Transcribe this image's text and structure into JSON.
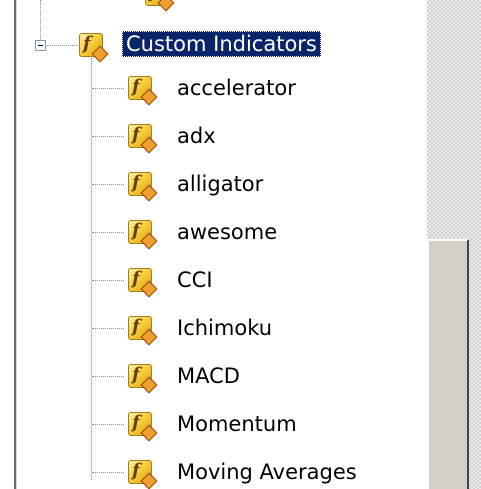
{
  "tree": {
    "parent": {
      "label": "Custom Indicators",
      "icon": "function-icon",
      "expanded": true
    },
    "items": [
      {
        "label": "accelerator",
        "icon": "function-icon"
      },
      {
        "label": "adx",
        "icon": "function-icon"
      },
      {
        "label": "alligator",
        "icon": "function-icon"
      },
      {
        "label": "awesome",
        "icon": "function-icon"
      },
      {
        "label": "CCI",
        "icon": "function-icon"
      },
      {
        "label": "Ichimoku",
        "icon": "function-icon"
      },
      {
        "label": "MACD",
        "icon": "function-icon"
      },
      {
        "label": "Momentum",
        "icon": "function-icon"
      },
      {
        "label": "Moving Averages",
        "icon": "function-icon"
      }
    ]
  },
  "colors": {
    "selection_bg": "#0a246a",
    "selection_fg": "#ffffff",
    "icon_gold": "#f6cf3a"
  }
}
